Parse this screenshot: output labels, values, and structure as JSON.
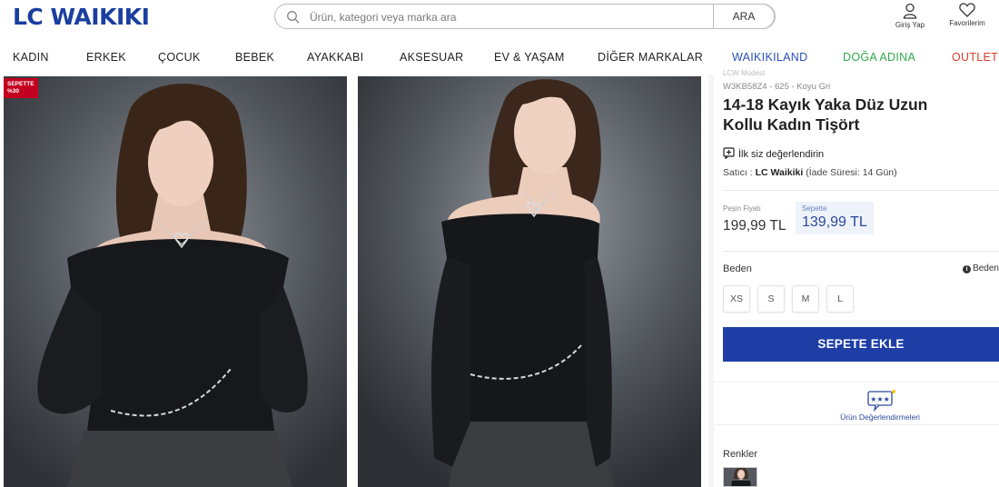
{
  "header": {
    "logo": "LC WAIKIKI",
    "search_placeholder": "Ürün, kategori veya marka ara",
    "search_button": "ARA",
    "login_label": "Giriş Yap",
    "favorites_label": "Favorilerim"
  },
  "nav": {
    "items": [
      {
        "label": "KADIN",
        "color": "#222222"
      },
      {
        "label": "ERKEK",
        "color": "#222222"
      },
      {
        "label": "ÇOCUK",
        "color": "#222222"
      },
      {
        "label": "BEBEK",
        "color": "#222222"
      },
      {
        "label": "AYAKKABI",
        "color": "#222222"
      },
      {
        "label": "AKSESUAR",
        "color": "#222222"
      },
      {
        "label": "EV & YAŞAM",
        "color": "#222222"
      },
      {
        "label": "DİĞER MARKALAR",
        "color": "#222222"
      },
      {
        "label": "WAIKIKILAND",
        "color": "#2b4fb8"
      },
      {
        "label": "DOĞA ADINA",
        "color": "#2faa4a"
      },
      {
        "label": "OUTLET",
        "color": "#d93b2a"
      }
    ]
  },
  "badge": {
    "line1": "SEPETTE",
    "line2": "%30"
  },
  "product": {
    "brand_line": "LCW Modest",
    "sku": "W3KB58Z4 - 625 - Koyu Gri",
    "title": "14-18 Kayık Yaka Düz Uzun Kollu Kadın Tişört",
    "review_prompt": "İlk siz değerlendirin",
    "seller_prefix": "Satıcı :",
    "seller_name": "LC Waikiki",
    "seller_suffix": "(İade Süresi: 14 Gün)",
    "cash_price_label": "Peşin Fiyatı",
    "cash_price": "199,99 TL",
    "cart_price_label": "Sepette",
    "cart_price": "139,99 TL",
    "size_label": "Beden",
    "size_guide": "Beden",
    "sizes": [
      "XS",
      "S",
      "M",
      "L"
    ],
    "add_to_cart": "SEPETE EKLE",
    "reviews_label": "Ürün Değerlendirmeleri",
    "colors_label": "Renkler"
  },
  "colors": {
    "brand_blue": "#1a3fa0",
    "button_blue": "#1e3ea6",
    "badge_red": "#c3001f"
  }
}
